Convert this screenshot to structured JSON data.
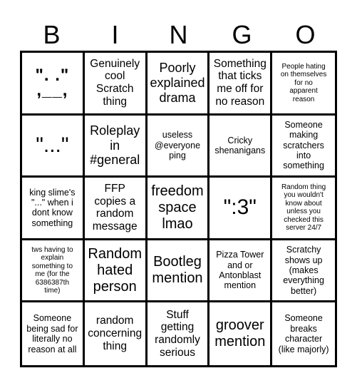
{
  "header": {
    "letters": [
      "B",
      "I",
      "N",
      "G",
      "O"
    ]
  },
  "board": {
    "cells": [
      {
        "text": "\".   .\"\n,__,",
        "size": "face"
      },
      {
        "text": "Genuinely\ncool\nScratch\nthing",
        "size": "s-md"
      },
      {
        "text": "Poorly\nexplained\ndrama",
        "size": "s-lg"
      },
      {
        "text": "Something\nthat ticks\nme off for\nno reason",
        "size": "s-md"
      },
      {
        "text": "People hating\non themselves\nfor no\napparent\nreason",
        "size": "s-xs"
      },
      {
        "text": "\"...\"",
        "size": "s-xxl"
      },
      {
        "text": "Roleplay\nin\n#general",
        "size": "s-lg"
      },
      {
        "text": "useless\n@everyone\nping",
        "size": "s-sm"
      },
      {
        "text": "Cricky\nshenanigans",
        "size": "s-sm"
      },
      {
        "text": "Someone\nmaking\nscratchers\ninto\nsomething",
        "size": "s-sm"
      },
      {
        "text": "king slime's\n\"...\" when i\ndont know\nsomething",
        "size": "s-sm"
      },
      {
        "text": "FFP\ncopies a\nrandom\nmessage",
        "size": "s-md"
      },
      {
        "text": "freedom\nspace\nlmao",
        "size": "s-xl"
      },
      {
        "text": "\":3\"",
        "size": "s-xxl"
      },
      {
        "text": "Random thing\nyou wouldn't\nknow about\nunless you\nchecked this\nserver 24/7",
        "size": "s-xs"
      },
      {
        "text": "tws having to\nexplain\nsomething to\nme (for the\n6386387th\ntime)",
        "size": "s-xs"
      },
      {
        "text": "Random\nhated\nperson",
        "size": "s-xl"
      },
      {
        "text": "Bootleg\nmention",
        "size": "s-xl"
      },
      {
        "text": "Pizza Tower\nand or\nAntonblast\nmention",
        "size": "s-sm"
      },
      {
        "text": "Scratchy\nshows up\n(makes\neverything\nbetter)",
        "size": "s-sm"
      },
      {
        "text": "Someone\nbeing sad for\nliterally no\nreason at all",
        "size": "s-sm"
      },
      {
        "text": "random\nconcerning\nthing",
        "size": "s-md"
      },
      {
        "text": "Stuff\ngetting\nrandomly\nserious",
        "size": "s-md"
      },
      {
        "text": "groover\nmention",
        "size": "s-xl"
      },
      {
        "text": "Someone\nbreaks\ncharacter\n(like majorly)",
        "size": "s-sm"
      }
    ]
  }
}
